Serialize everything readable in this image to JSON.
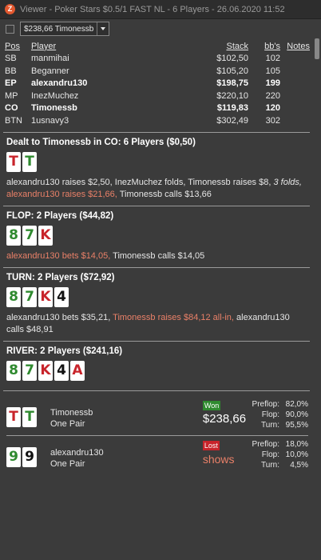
{
  "window": {
    "app_icon": "Z",
    "title": "Viewer - Poker Stars $0.5/1 FAST NL - 6 Players - 26.06.2020 11:52"
  },
  "toolbar": {
    "selected_hand": "$238,66 Timonessb"
  },
  "table": {
    "headers": {
      "pos": "Pos",
      "player": "Player",
      "stack": "Stack",
      "bbs": "bb's",
      "notes": "Notes"
    },
    "rows": [
      {
        "pos": "SB",
        "player": "manmihai",
        "stack": "$102,50",
        "bbs": "102"
      },
      {
        "pos": "BB",
        "player": "Beganner",
        "stack": "$105,20",
        "bbs": "105"
      },
      {
        "pos": "EP",
        "player": "alexandru130",
        "stack": "$198,75",
        "bbs": "199"
      },
      {
        "pos": "MP",
        "player": "InezMuchez",
        "stack": "$220,10",
        "bbs": "220"
      },
      {
        "pos": "CO",
        "player": "Timonessb",
        "stack": "$119,83",
        "bbs": "120"
      },
      {
        "pos": "BTN",
        "player": "1usnavy3",
        "stack": "$302,49",
        "bbs": "302"
      }
    ]
  },
  "preflop": {
    "title": "Dealt to Timonessb in CO: 6 Players ($0,50)",
    "cards": [
      {
        "rank": "T",
        "suit": "hearts"
      },
      {
        "rank": "T",
        "suit": "clubs"
      }
    ],
    "a1": "alexandru130 raises $2,50, InezMuchez folds, Timonessb raises $8,",
    "a2": "3 folds,",
    "a3": "alexandru130 raises $21,66,",
    "a4": "Timonessb calls $13,66"
  },
  "flop": {
    "title": "FLOP: 2 Players ($44,82)",
    "cards": [
      {
        "rank": "8",
        "suit": "clubs"
      },
      {
        "rank": "7",
        "suit": "clubs"
      },
      {
        "rank": "K",
        "suit": "hearts"
      }
    ],
    "a1": "alexandru130 bets $14,05,",
    "a2": "Timonessb calls $14,05"
  },
  "turn": {
    "title": "TURN: 2 Players ($72,92)",
    "cards": [
      {
        "rank": "8",
        "suit": "clubs"
      },
      {
        "rank": "7",
        "suit": "clubs"
      },
      {
        "rank": "K",
        "suit": "hearts"
      },
      {
        "rank": "4",
        "suit": "spades"
      }
    ],
    "a1": "alexandru130 bets $35,21,",
    "a2": "Timonessb raises $84,12 all-in,",
    "a3": "alexandru130 calls $48,91"
  },
  "river": {
    "title": "RIVER: 2 Players ($241,16)",
    "cards": [
      {
        "rank": "8",
        "suit": "clubs"
      },
      {
        "rank": "7",
        "suit": "clubs"
      },
      {
        "rank": "K",
        "suit": "hearts"
      },
      {
        "rank": "4",
        "suit": "spades"
      },
      {
        "rank": "A",
        "suit": "hearts"
      }
    ]
  },
  "results": [
    {
      "cards": [
        {
          "rank": "T",
          "suit": "hearts"
        },
        {
          "rank": "T",
          "suit": "clubs"
        }
      ],
      "player": "Timonessb",
      "hand": "One Pair",
      "badge": "Won",
      "amount": "$238,66",
      "stats": [
        {
          "label": "Preflop:",
          "value": "82,0%"
        },
        {
          "label": "Flop:",
          "value": "90,0%"
        },
        {
          "label": "Turn:",
          "value": "95,5%"
        }
      ]
    },
    {
      "cards": [
        {
          "rank": "9",
          "suit": "clubs"
        },
        {
          "rank": "9",
          "suit": "spades"
        }
      ],
      "player": "alexandru130",
      "hand": "One Pair",
      "badge": "Lost",
      "amount": "shows",
      "stats": [
        {
          "label": "Preflop:",
          "value": "18,0%"
        },
        {
          "label": "Flop:",
          "value": "10,0%"
        },
        {
          "label": "Turn:",
          "value": "4,5%"
        }
      ]
    }
  ],
  "colors": {
    "background": "#3b3b3b",
    "hero_action": "#e98068",
    "won": "#2f8a2f",
    "lost": "#c8242b",
    "hearts": "#c8242b",
    "clubs": "#2f8a2f",
    "spades": "#111111"
  }
}
